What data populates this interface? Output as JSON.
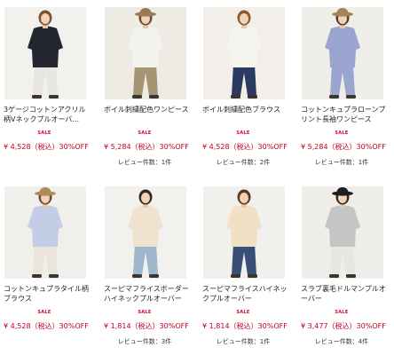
{
  "sale_label": "SALE",
  "colors": {
    "sale": "#d2002b",
    "price": "#c4001e"
  },
  "products": [
    {
      "name": "3ゲージコットンアクリル 柄Vネックプルオーバ...",
      "sale": "SALE",
      "price": "¥ 4,528（税込）30%OFF",
      "reviews": "",
      "look": {
        "bg": "#f3f1ee",
        "top": "#23262e",
        "bottom": "#e8e6e2",
        "hair": "#7a5232",
        "hat": ""
      }
    },
    {
      "name": "ボイル刺繍配色ワンピース",
      "sale": "SALE",
      "price": "¥ 5,284（税込）30%OFF",
      "reviews": "レビュー件数：1件",
      "look": {
        "bg": "#eeeae4",
        "top": "#f4f2ec",
        "bottom": "#a59574",
        "hair": "#6a4a2e",
        "hat": "#9a7a4e"
      }
    },
    {
      "name": "ボイル刺繍配色ブラウス",
      "sale": "SALE",
      "price": "¥ 4,528（税込）30%OFF",
      "reviews": "レビュー件数：2件",
      "look": {
        "bg": "#f2efea",
        "top": "#f6f4ee",
        "bottom": "#2a3a60",
        "hair": "#8a5a2e",
        "hat": ""
      }
    },
    {
      "name": "コットンキュプラローンプ リント長袖ワンピース",
      "sale": "SALE",
      "price": "¥ 5,284（税込）30%OFF",
      "reviews": "レビュー件数：1件",
      "look": {
        "bg": "#f0eee9",
        "top": "#9aa6cf",
        "bottom": "#9aa6cf",
        "hair": "#5a3a22",
        "hat": "#a58358"
      }
    },
    {
      "name": "コットンキュプラタイル柄 ブラウス",
      "sale": "SALE",
      "price": "¥ 4,528（税込）30%OFF",
      "reviews": "",
      "look": {
        "bg": "#f1efeb",
        "top": "#c3cde6",
        "bottom": "#e9e4dc",
        "hair": "#6a4a2e",
        "hat": "#b08a5a"
      }
    },
    {
      "name": "スーピマフライスボーダー ハイネックプルオーバー",
      "sale": "SALE",
      "price": "¥ 1,814（税込）30%OFF",
      "reviews": "レビュー件数：3件",
      "look": {
        "bg": "#f3f1ed",
        "top": "#efe3cf",
        "bottom": "#9fb6cc",
        "hair": "#3a2a1e",
        "hat": ""
      }
    },
    {
      "name": "スーピマフライスハイネッ クプルオーバー",
      "sale": "SALE",
      "price": "¥ 1,814（税込）30%OFF",
      "reviews": "レビュー件数：1件",
      "look": {
        "bg": "#f2f0ec",
        "top": "#f1dfc6",
        "bottom": "#3a4f75",
        "hair": "#5a3a22",
        "hat": ""
      }
    },
    {
      "name": "スラブ裏毛ドルマンプルオ ーバー",
      "sale": "SALE",
      "price": "¥ 3,477（税込）30%OFF",
      "reviews": "レビュー件数：4件",
      "look": {
        "bg": "#efeeea",
        "top": "#c3c6c2",
        "bottom": "#e8e6e1",
        "hair": "#3a2a1e",
        "hat": "#1e1e1e"
      }
    }
  ]
}
